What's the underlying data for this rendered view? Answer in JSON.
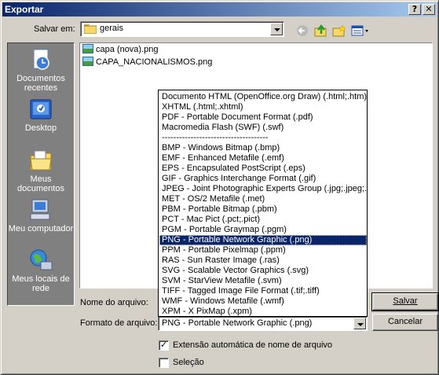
{
  "window": {
    "title": "Exportar",
    "help_btn": "?",
    "close_btn": "✕"
  },
  "save_in": {
    "label": "Salvar em:",
    "value": "gerais"
  },
  "places": [
    {
      "label": "Documentos recentes"
    },
    {
      "label": "Desktop"
    },
    {
      "label": "Meus documentos"
    },
    {
      "label": "Meu computador"
    },
    {
      "label": "Meus locais de rede"
    }
  ],
  "files": [
    "capa (nova).png",
    "CAPA_NACIONALISMOS.png"
  ],
  "filename": {
    "label": "Nome do arquivo:",
    "value": ""
  },
  "format": {
    "label": "Formato de arquivo:",
    "value": "PNG - Portable Network Graphic (.png)",
    "options": [
      "Documento HTML (OpenOffice.org Draw) (.html;.htm)",
      "XHTML (.html;.xhtml)",
      "PDF - Portable Document Format (.pdf)",
      "Macromedia Flash (SWF) (.swf)",
      "-------------------------------------",
      "BMP - Windows Bitmap (.bmp)",
      "EMF - Enhanced Metafile (.emf)",
      "EPS - Encapsulated PostScript (.eps)",
      "GIF - Graphics Interchange Format (.gif)",
      "JPEG - Joint Photographic Experts Group (.jpg;.jpeg;.jfif;",
      "MET - OS/2 Metafile (.met)",
      "PBM - Portable Bitmap (.pbm)",
      "PCT - Mac Pict (.pct;.pict)",
      "PGM - Portable Graymap (.pgm)",
      "PNG - Portable Network Graphic (.png)",
      "PPM - Portable Pixelmap (.ppm)",
      "RAS - Sun Raster Image (.ras)",
      "SVG - Scalable Vector Graphics (.svg)",
      "SVM - StarView Metafile (.svm)",
      "TIFF - Tagged Image File Format (.tif;.tiff)",
      "WMF - Windows Metafile (.wmf)",
      "XPM - X PixMap (.xpm)"
    ],
    "selected_index": 14
  },
  "buttons": {
    "save": "Salvar",
    "cancel": "Cancelar"
  },
  "checkboxes": {
    "auto_ext": {
      "label": "Extensão automática de nome de arquivo",
      "checked": true
    },
    "selection": {
      "label": "Seleção",
      "checked": false
    }
  }
}
